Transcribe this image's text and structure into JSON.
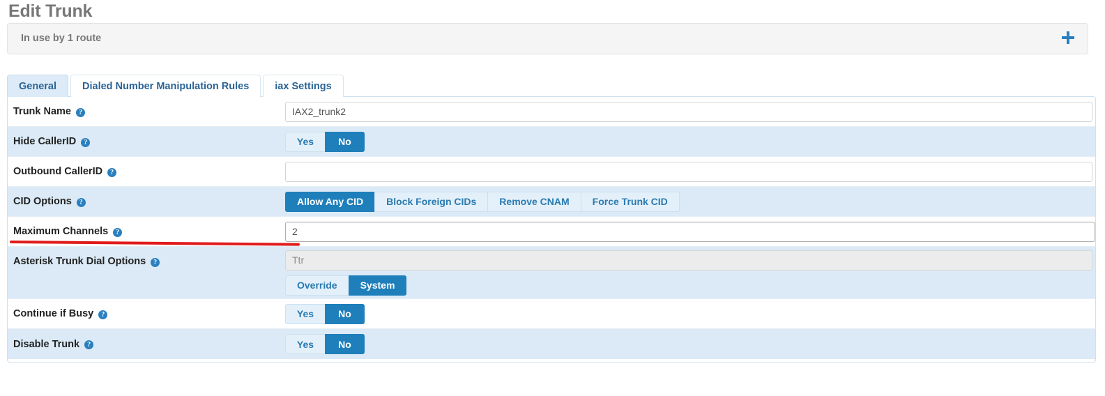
{
  "page": {
    "title": "Edit Trunk"
  },
  "banner": {
    "text": "In use by 1 route",
    "expand_icon": "plus-icon"
  },
  "tabs": [
    {
      "label": "General",
      "active": true
    },
    {
      "label": "Dialed Number Manipulation Rules",
      "active": false
    },
    {
      "label": "iax Settings",
      "active": false
    }
  ],
  "form": {
    "rows": [
      {
        "label": "Trunk Name",
        "help_icon": "help-circle-icon",
        "type": "text",
        "value": "IAX2_trunk2",
        "placeholder": ""
      },
      {
        "label": "Hide CallerID",
        "help_icon": "help-circle-icon",
        "type": "buttons",
        "options": [
          "Yes",
          "No"
        ],
        "selected": "No"
      },
      {
        "label": "Outbound CallerID",
        "help_icon": "help-circle-icon",
        "type": "text",
        "value": "",
        "placeholder": ""
      },
      {
        "label": "CID Options",
        "help_icon": "help-circle-icon",
        "type": "buttons",
        "options": [
          "Allow Any CID",
          "Block Foreign CIDs",
          "Remove CNAM",
          "Force Trunk CID"
        ],
        "selected": "Allow Any CID"
      },
      {
        "label": "Maximum Channels",
        "help_icon": "help-circle-icon",
        "type": "text",
        "value": "2",
        "placeholder": ""
      },
      {
        "label": "Asterisk Trunk Dial Options",
        "help_icon": "help-circle-icon",
        "type": "text-and-buttons",
        "value": "Ttr",
        "disabled": true,
        "options": [
          "Override",
          "System"
        ],
        "selected": "System"
      },
      {
        "label": "Continue if Busy",
        "help_icon": "help-circle-icon",
        "type": "buttons",
        "options": [
          "Yes",
          "No"
        ],
        "selected": "No"
      },
      {
        "label": "Disable Trunk",
        "help_icon": "help-circle-icon",
        "type": "buttons",
        "options": [
          "Yes",
          "No"
        ],
        "selected": "No"
      }
    ]
  },
  "annotation": {
    "color": "#e01b1b",
    "target": "Maximum Channels"
  },
  "colors": {
    "accent": "#1f7fba",
    "row_alt": "#dbeaf6",
    "tab_active": "#dcebf7",
    "title": "#777777",
    "annotation": "#e01b1b"
  },
  "help_glyph": "?"
}
